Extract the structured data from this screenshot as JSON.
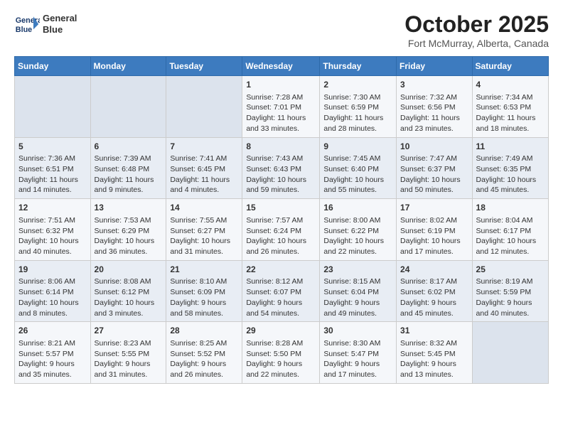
{
  "header": {
    "logo_line1": "General",
    "logo_line2": "Blue",
    "month": "October 2025",
    "location": "Fort McMurray, Alberta, Canada"
  },
  "weekdays": [
    "Sunday",
    "Monday",
    "Tuesday",
    "Wednesday",
    "Thursday",
    "Friday",
    "Saturday"
  ],
  "weeks": [
    [
      {
        "day": "",
        "content": ""
      },
      {
        "day": "",
        "content": ""
      },
      {
        "day": "",
        "content": ""
      },
      {
        "day": "1",
        "content": "Sunrise: 7:28 AM\nSunset: 7:01 PM\nDaylight: 11 hours\nand 33 minutes."
      },
      {
        "day": "2",
        "content": "Sunrise: 7:30 AM\nSunset: 6:59 PM\nDaylight: 11 hours\nand 28 minutes."
      },
      {
        "day": "3",
        "content": "Sunrise: 7:32 AM\nSunset: 6:56 PM\nDaylight: 11 hours\nand 23 minutes."
      },
      {
        "day": "4",
        "content": "Sunrise: 7:34 AM\nSunset: 6:53 PM\nDaylight: 11 hours\nand 18 minutes."
      }
    ],
    [
      {
        "day": "5",
        "content": "Sunrise: 7:36 AM\nSunset: 6:51 PM\nDaylight: 11 hours\nand 14 minutes."
      },
      {
        "day": "6",
        "content": "Sunrise: 7:39 AM\nSunset: 6:48 PM\nDaylight: 11 hours\nand 9 minutes."
      },
      {
        "day": "7",
        "content": "Sunrise: 7:41 AM\nSunset: 6:45 PM\nDaylight: 11 hours\nand 4 minutes."
      },
      {
        "day": "8",
        "content": "Sunrise: 7:43 AM\nSunset: 6:43 PM\nDaylight: 10 hours\nand 59 minutes."
      },
      {
        "day": "9",
        "content": "Sunrise: 7:45 AM\nSunset: 6:40 PM\nDaylight: 10 hours\nand 55 minutes."
      },
      {
        "day": "10",
        "content": "Sunrise: 7:47 AM\nSunset: 6:37 PM\nDaylight: 10 hours\nand 50 minutes."
      },
      {
        "day": "11",
        "content": "Sunrise: 7:49 AM\nSunset: 6:35 PM\nDaylight: 10 hours\nand 45 minutes."
      }
    ],
    [
      {
        "day": "12",
        "content": "Sunrise: 7:51 AM\nSunset: 6:32 PM\nDaylight: 10 hours\nand 40 minutes."
      },
      {
        "day": "13",
        "content": "Sunrise: 7:53 AM\nSunset: 6:29 PM\nDaylight: 10 hours\nand 36 minutes."
      },
      {
        "day": "14",
        "content": "Sunrise: 7:55 AM\nSunset: 6:27 PM\nDaylight: 10 hours\nand 31 minutes."
      },
      {
        "day": "15",
        "content": "Sunrise: 7:57 AM\nSunset: 6:24 PM\nDaylight: 10 hours\nand 26 minutes."
      },
      {
        "day": "16",
        "content": "Sunrise: 8:00 AM\nSunset: 6:22 PM\nDaylight: 10 hours\nand 22 minutes."
      },
      {
        "day": "17",
        "content": "Sunrise: 8:02 AM\nSunset: 6:19 PM\nDaylight: 10 hours\nand 17 minutes."
      },
      {
        "day": "18",
        "content": "Sunrise: 8:04 AM\nSunset: 6:17 PM\nDaylight: 10 hours\nand 12 minutes."
      }
    ],
    [
      {
        "day": "19",
        "content": "Sunrise: 8:06 AM\nSunset: 6:14 PM\nDaylight: 10 hours\nand 8 minutes."
      },
      {
        "day": "20",
        "content": "Sunrise: 8:08 AM\nSunset: 6:12 PM\nDaylight: 10 hours\nand 3 minutes."
      },
      {
        "day": "21",
        "content": "Sunrise: 8:10 AM\nSunset: 6:09 PM\nDaylight: 9 hours\nand 58 minutes."
      },
      {
        "day": "22",
        "content": "Sunrise: 8:12 AM\nSunset: 6:07 PM\nDaylight: 9 hours\nand 54 minutes."
      },
      {
        "day": "23",
        "content": "Sunrise: 8:15 AM\nSunset: 6:04 PM\nDaylight: 9 hours\nand 49 minutes."
      },
      {
        "day": "24",
        "content": "Sunrise: 8:17 AM\nSunset: 6:02 PM\nDaylight: 9 hours\nand 45 minutes."
      },
      {
        "day": "25",
        "content": "Sunrise: 8:19 AM\nSunset: 5:59 PM\nDaylight: 9 hours\nand 40 minutes."
      }
    ],
    [
      {
        "day": "26",
        "content": "Sunrise: 8:21 AM\nSunset: 5:57 PM\nDaylight: 9 hours\nand 35 minutes."
      },
      {
        "day": "27",
        "content": "Sunrise: 8:23 AM\nSunset: 5:55 PM\nDaylight: 9 hours\nand 31 minutes."
      },
      {
        "day": "28",
        "content": "Sunrise: 8:25 AM\nSunset: 5:52 PM\nDaylight: 9 hours\nand 26 minutes."
      },
      {
        "day": "29",
        "content": "Sunrise: 8:28 AM\nSunset: 5:50 PM\nDaylight: 9 hours\nand 22 minutes."
      },
      {
        "day": "30",
        "content": "Sunrise: 8:30 AM\nSunset: 5:47 PM\nDaylight: 9 hours\nand 17 minutes."
      },
      {
        "day": "31",
        "content": "Sunrise: 8:32 AM\nSunset: 5:45 PM\nDaylight: 9 hours\nand 13 minutes."
      },
      {
        "day": "",
        "content": ""
      }
    ]
  ]
}
